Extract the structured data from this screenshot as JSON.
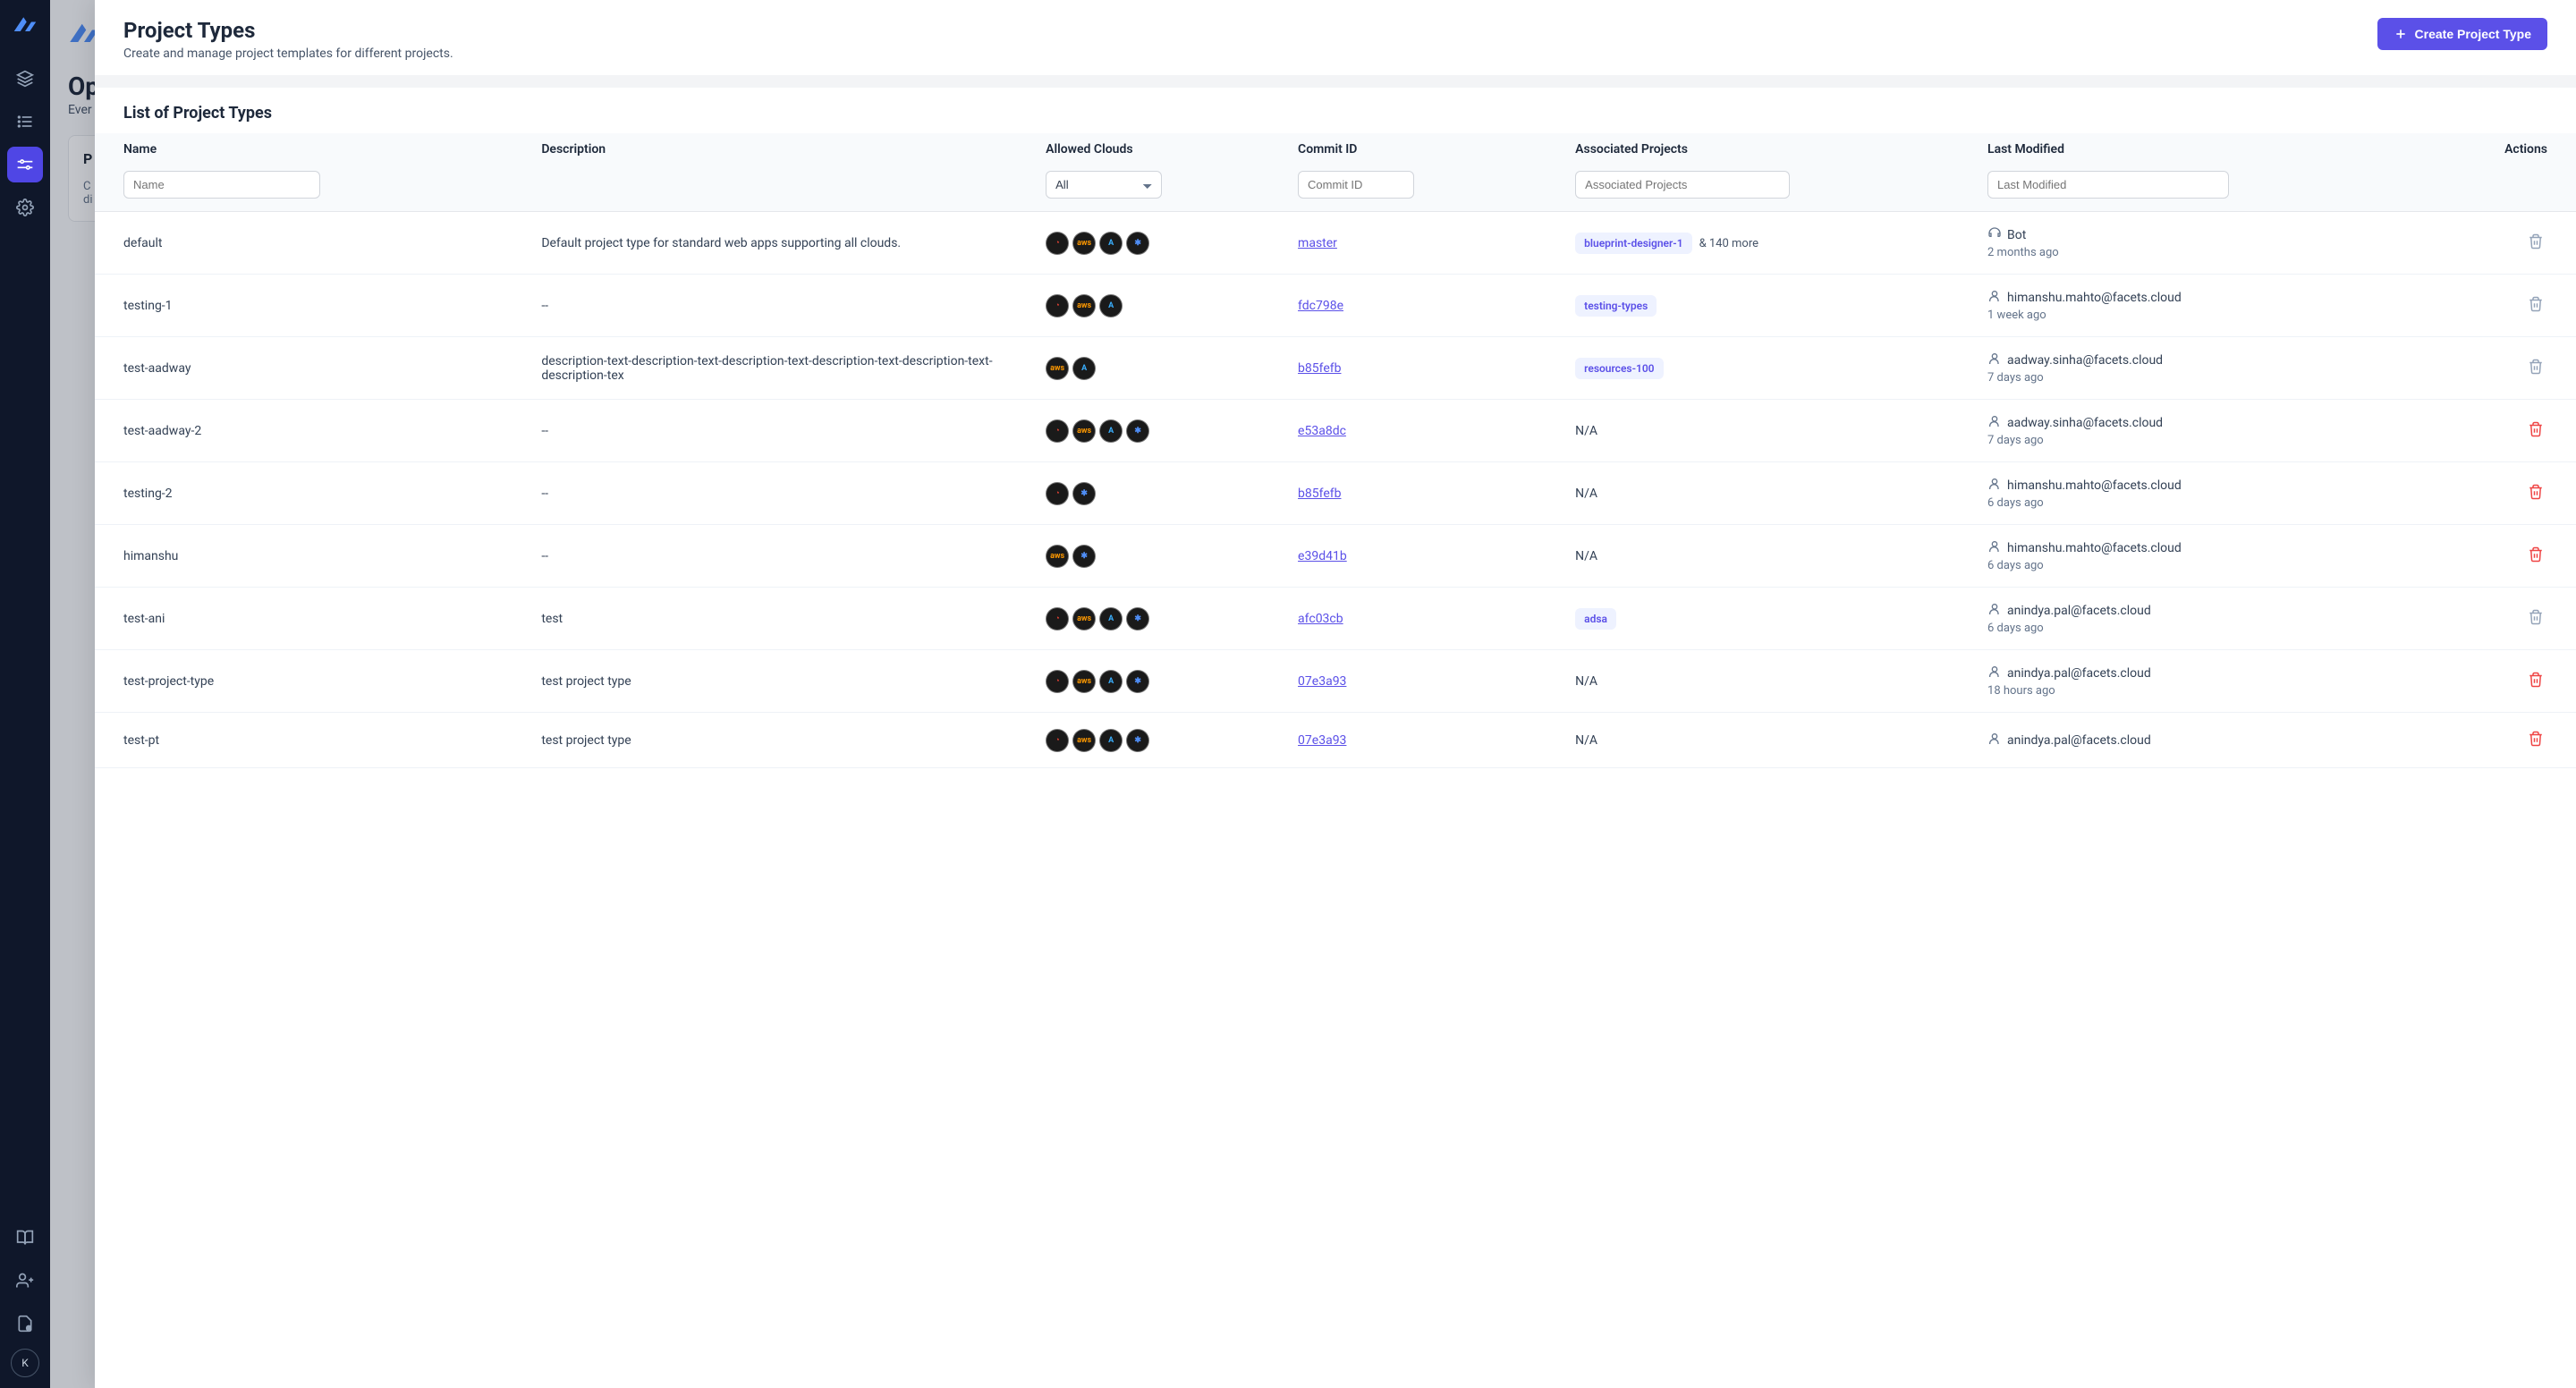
{
  "sidebar": {
    "avatar_initial": "K"
  },
  "bg": {
    "title_prefix": "Op",
    "subtitle_prefix": "Ever",
    "card_title_prefix": "P",
    "card_line1": "C",
    "card_line2": "di"
  },
  "header": {
    "title": "Project Types",
    "subtitle": "Create and manage project templates for different projects.",
    "create_btn": "Create Project Type"
  },
  "list_title": "List of Project Types",
  "columns": {
    "name": "Name",
    "description": "Description",
    "allowed_clouds": "Allowed Clouds",
    "commit_id": "Commit ID",
    "associated_projects": "Associated Projects",
    "last_modified": "Last Modified",
    "actions": "Actions"
  },
  "filters": {
    "name_placeholder": "Name",
    "clouds_value": "All",
    "commit_placeholder": "Commit ID",
    "projects_placeholder": "Associated Projects",
    "modified_placeholder": "Last Modified"
  },
  "rows": [
    {
      "name": "default",
      "description": "Default project type for standard web apps supporting all clouds.",
      "clouds": [
        "gcp",
        "aws",
        "azure",
        "k8s"
      ],
      "commit": "master",
      "projects": {
        "badge": "blueprint-designer-1",
        "more": "& 140 more"
      },
      "user": "Bot",
      "user_icon": "bot",
      "time": "2 months ago",
      "delete_style": "muted"
    },
    {
      "name": "testing-1",
      "description": "--",
      "clouds": [
        "gcp",
        "aws",
        "azure"
      ],
      "commit": "fdc798e",
      "projects": {
        "badge": "testing-types"
      },
      "user": "himanshu.mahto@facets.cloud",
      "user_icon": "person",
      "time": "1 week ago",
      "delete_style": "muted"
    },
    {
      "name": "test-aadway",
      "description": "description-text-description-text-description-text-description-text-description-text-description-tex",
      "clouds": [
        "aws",
        "azure"
      ],
      "commit": "b85fefb",
      "projects": {
        "badge": "resources-100"
      },
      "user": "aadway.sinha@facets.cloud",
      "user_icon": "person",
      "time": "7 days ago",
      "delete_style": "muted"
    },
    {
      "name": "test-aadway-2",
      "description": "--",
      "clouds": [
        "gcp",
        "aws",
        "azure",
        "k8s"
      ],
      "commit": "e53a8dc",
      "projects": {
        "na": "N/A"
      },
      "user": "aadway.sinha@facets.cloud",
      "user_icon": "person",
      "time": "7 days ago",
      "delete_style": "danger"
    },
    {
      "name": "testing-2",
      "description": "--",
      "clouds": [
        "gcp",
        "k8s"
      ],
      "commit": "b85fefb",
      "projects": {
        "na": "N/A"
      },
      "user": "himanshu.mahto@facets.cloud",
      "user_icon": "person",
      "time": "6 days ago",
      "delete_style": "danger"
    },
    {
      "name": "himanshu",
      "description": "--",
      "clouds": [
        "aws",
        "k8s"
      ],
      "commit": "e39d41b",
      "projects": {
        "na": "N/A"
      },
      "user": "himanshu.mahto@facets.cloud",
      "user_icon": "person",
      "time": "6 days ago",
      "delete_style": "danger"
    },
    {
      "name": "test-ani",
      "description": "test",
      "clouds": [
        "gcp",
        "aws",
        "azure",
        "k8s"
      ],
      "commit": "afc03cb",
      "projects": {
        "badge": "adsa"
      },
      "user": "anindya.pal@facets.cloud",
      "user_icon": "person",
      "time": "6 days ago",
      "delete_style": "muted"
    },
    {
      "name": "test-project-type",
      "description": "test project type",
      "clouds": [
        "gcp",
        "aws",
        "azure",
        "k8s"
      ],
      "commit": "07e3a93",
      "projects": {
        "na": "N/A"
      },
      "user": "anindya.pal@facets.cloud",
      "user_icon": "person",
      "time": "18 hours ago",
      "delete_style": "danger"
    },
    {
      "name": "test-pt",
      "description": "test project type",
      "clouds": [
        "gcp",
        "aws",
        "azure",
        "k8s"
      ],
      "commit": "07e3a93",
      "projects": {
        "na": "N/A"
      },
      "user": "anindya.pal@facets.cloud",
      "user_icon": "person",
      "time": "",
      "delete_style": "danger"
    }
  ],
  "cloud_letters": {
    "gcp": "◔",
    "aws": "aws",
    "azure": "A",
    "k8s": "✱"
  },
  "cloud_colors": {
    "gcp": "#ea4335",
    "aws": "#ff9900",
    "azure": "#3ab0ff",
    "k8s": "#4f8ef7"
  }
}
